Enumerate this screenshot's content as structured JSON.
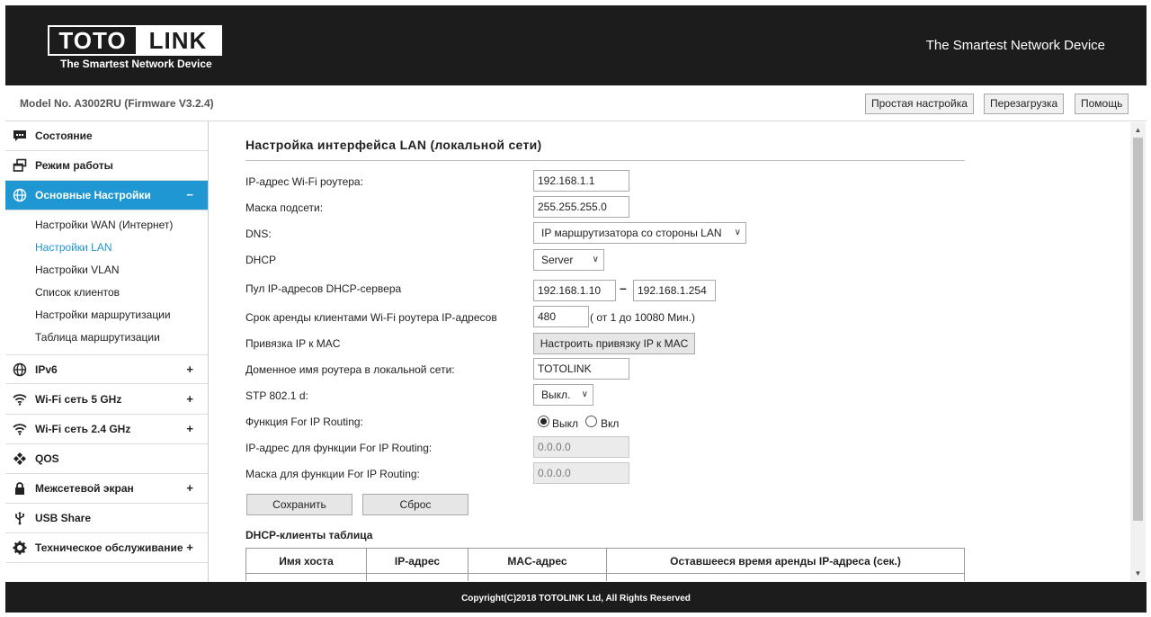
{
  "header": {
    "logo_left": "TOTO",
    "logo_right": "LINK",
    "logo_tagline": "The Smartest Network Device",
    "slogan": "The Smartest Network Device"
  },
  "modelbar": {
    "model": "Model No. A3002RU (Firmware V3.2.4)",
    "buttons": [
      "Простая настройка",
      "Перезагрузка",
      "Помощь"
    ]
  },
  "sidebar": {
    "items": [
      {
        "label": "Состояние",
        "icon": "chat-bubble-icon",
        "toggle": ""
      },
      {
        "label": "Режим работы",
        "icon": "windows-icon",
        "toggle": ""
      },
      {
        "label": "Основные Настройки",
        "icon": "globe-icon",
        "toggle": "−"
      },
      {
        "label": "IPv6",
        "icon": "globe-icon",
        "toggle": "+"
      },
      {
        "label": "Wi-Fi сеть 5 GHz",
        "icon": "wifi-icon",
        "toggle": "+"
      },
      {
        "label": "Wi-Fi сеть 2.4 GHz",
        "icon": "wifi-icon",
        "toggle": "+"
      },
      {
        "label": "QOS",
        "icon": "qos-icon",
        "toggle": ""
      },
      {
        "label": "Межсетевой экран",
        "icon": "lock-icon",
        "toggle": "+"
      },
      {
        "label": "USB Share",
        "icon": "usb-icon",
        "toggle": ""
      },
      {
        "label": "Техническое обслуживание",
        "icon": "gear-icon",
        "toggle": "+"
      }
    ],
    "subitems": [
      "Настройки WAN (Интернет)",
      "Настройки LAN",
      "Настройки VLAN",
      "Список клиентов",
      "Настройки маршрутизации",
      "Таблица маршрутизации"
    ]
  },
  "main": {
    "title": "Настройка интерфейса LAN (локальной сети)",
    "labels": {
      "ip": "IP-адрес Wi-Fi роутера:",
      "mask": "Маска подсети:",
      "dns": "DNS:",
      "dhcp": "DHCP",
      "pool": "Пул IP-адресов DHCP-сервера",
      "lease": "Срок аренды клиентами Wi-Fi роутера IP-адресов",
      "bind": "Привязка IP к MAC",
      "domain": "Доменное имя роутера в локальной сети:",
      "stp": "STP 802.1 d:",
      "routing": "Функция For IP Routing:",
      "routing_ip": "IP-адрес для функции For IP Routing:",
      "routing_mask": "Маска для функции For IP Routing:"
    },
    "values": {
      "ip": "192.168.1.1",
      "mask": "255.255.255.0",
      "dns": "IP маршрутизатора со стороны LAN",
      "dhcp": "Server",
      "pool_start": "192.168.1.10",
      "pool_dash": "–",
      "pool_end": "192.168.1.254",
      "lease": "480",
      "lease_hint": "( от 1 до 10080 Мин.)",
      "bind_button": "Настроить привязку IP к MAC",
      "domain": "TOTOLINK",
      "stp": "Выкл.",
      "routing_off": "Выкл",
      "routing_on": "Вкл",
      "routing_ip": "0.0.0.0",
      "routing_mask": "0.0.0.0"
    },
    "buttons": {
      "save": "Сохранить",
      "reset": "Сброс"
    },
    "dhcp_table": {
      "title": "DHCP-клиенты таблица",
      "headers": [
        "Имя хоста",
        "IP-адрес",
        "MAC-адрес",
        "Оставшееся время аренды IP-адреса (сек.)"
      ]
    }
  },
  "footer": {
    "copyright": "Copyright(C)2018 TOTOLINK Ltd, All Rights Reserved"
  }
}
